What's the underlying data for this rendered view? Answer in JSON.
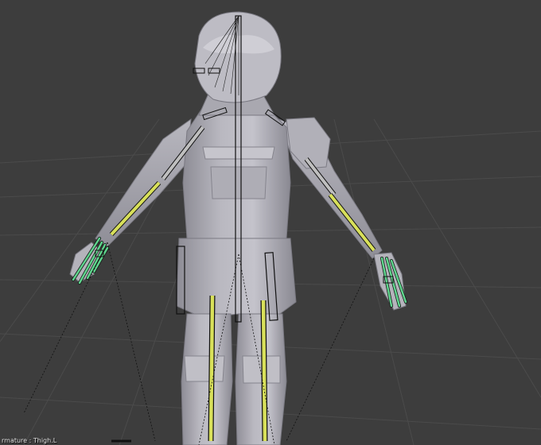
{
  "viewport": {
    "status_text": "rmature : Thigh.L"
  },
  "colors": {
    "background": "#3d3d3d",
    "grid": "#4b4b4b",
    "mesh": "#b3b2ba",
    "mesh_shadow": "#7a7982",
    "bone_selected": "#d8e05a",
    "bone_hand": "#5fd48d",
    "bone_wire": "#1a1a1a"
  },
  "icons": {
    "armature": "armature-icon",
    "character": "character-mesh-icon"
  }
}
